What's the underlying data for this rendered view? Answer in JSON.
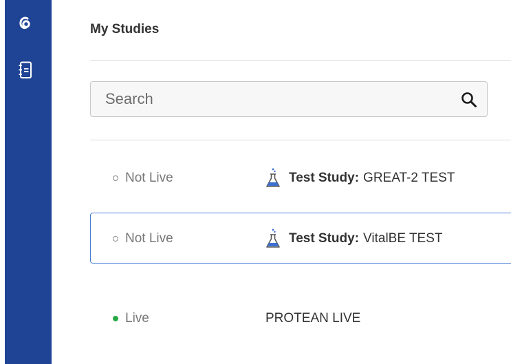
{
  "sidebar": {
    "logo_icon": "app-logo-icon",
    "items": [
      {
        "icon": "notebook-icon"
      }
    ],
    "background": "#1f4495"
  },
  "page": {
    "title": "My Studies"
  },
  "search": {
    "placeholder": "Search",
    "value": "",
    "icon": "search-icon"
  },
  "studies": [
    {
      "status": "Not Live",
      "is_live": false,
      "is_test": true,
      "prefix": "Test Study:",
      "name": "GREAT-2 TEST",
      "selected": false
    },
    {
      "status": "Not Live",
      "is_live": false,
      "is_test": true,
      "prefix": "Test Study:",
      "name": "VitalBE TEST",
      "selected": true
    },
    {
      "status": "Live",
      "is_live": true,
      "is_test": false,
      "name": "PROTEAN LIVE",
      "selected": false
    }
  ],
  "colors": {
    "accent": "#4a7fd6",
    "live": "#27a844",
    "test_flask": "#3b6fd0"
  }
}
